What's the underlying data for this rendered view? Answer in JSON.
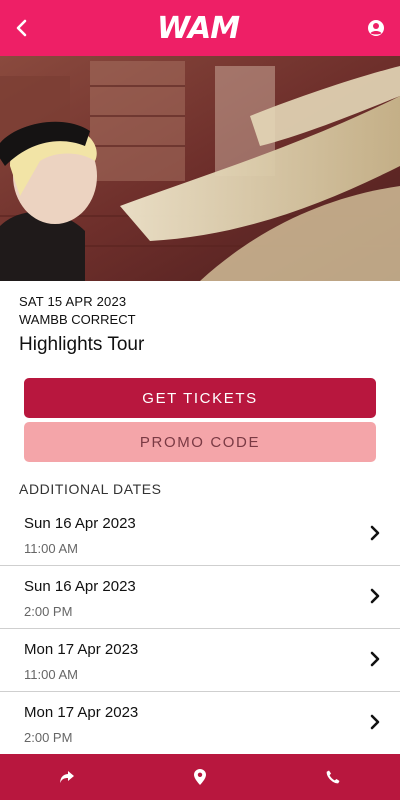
{
  "header": {
    "logo_text": "WAM"
  },
  "event": {
    "date": "SAT 15 APR 2023",
    "venue": "WAMBB CORRECT",
    "title": "Highlights Tour"
  },
  "actions": {
    "get_tickets": "GET TICKETS",
    "promo_code": "PROMO CODE"
  },
  "additional": {
    "heading": "ADDITIONAL DATES",
    "items": [
      {
        "date": "Sun 16 Apr 2023",
        "time": "11:00 AM"
      },
      {
        "date": "Sun 16 Apr 2023",
        "time": "2:00 PM"
      },
      {
        "date": "Mon 17 Apr 2023",
        "time": "11:00 AM"
      },
      {
        "date": "Mon 17 Apr 2023",
        "time": "2:00 PM"
      }
    ]
  },
  "colors": {
    "brand_pink": "#ee1f66",
    "brand_crimson": "#b8173e",
    "promo_pink": "#f4a5a9"
  },
  "icons": {
    "back": "chevron-left-icon",
    "account": "user-circle-icon",
    "share": "share-arrow-icon",
    "location": "map-pin-icon",
    "phone": "phone-icon"
  }
}
